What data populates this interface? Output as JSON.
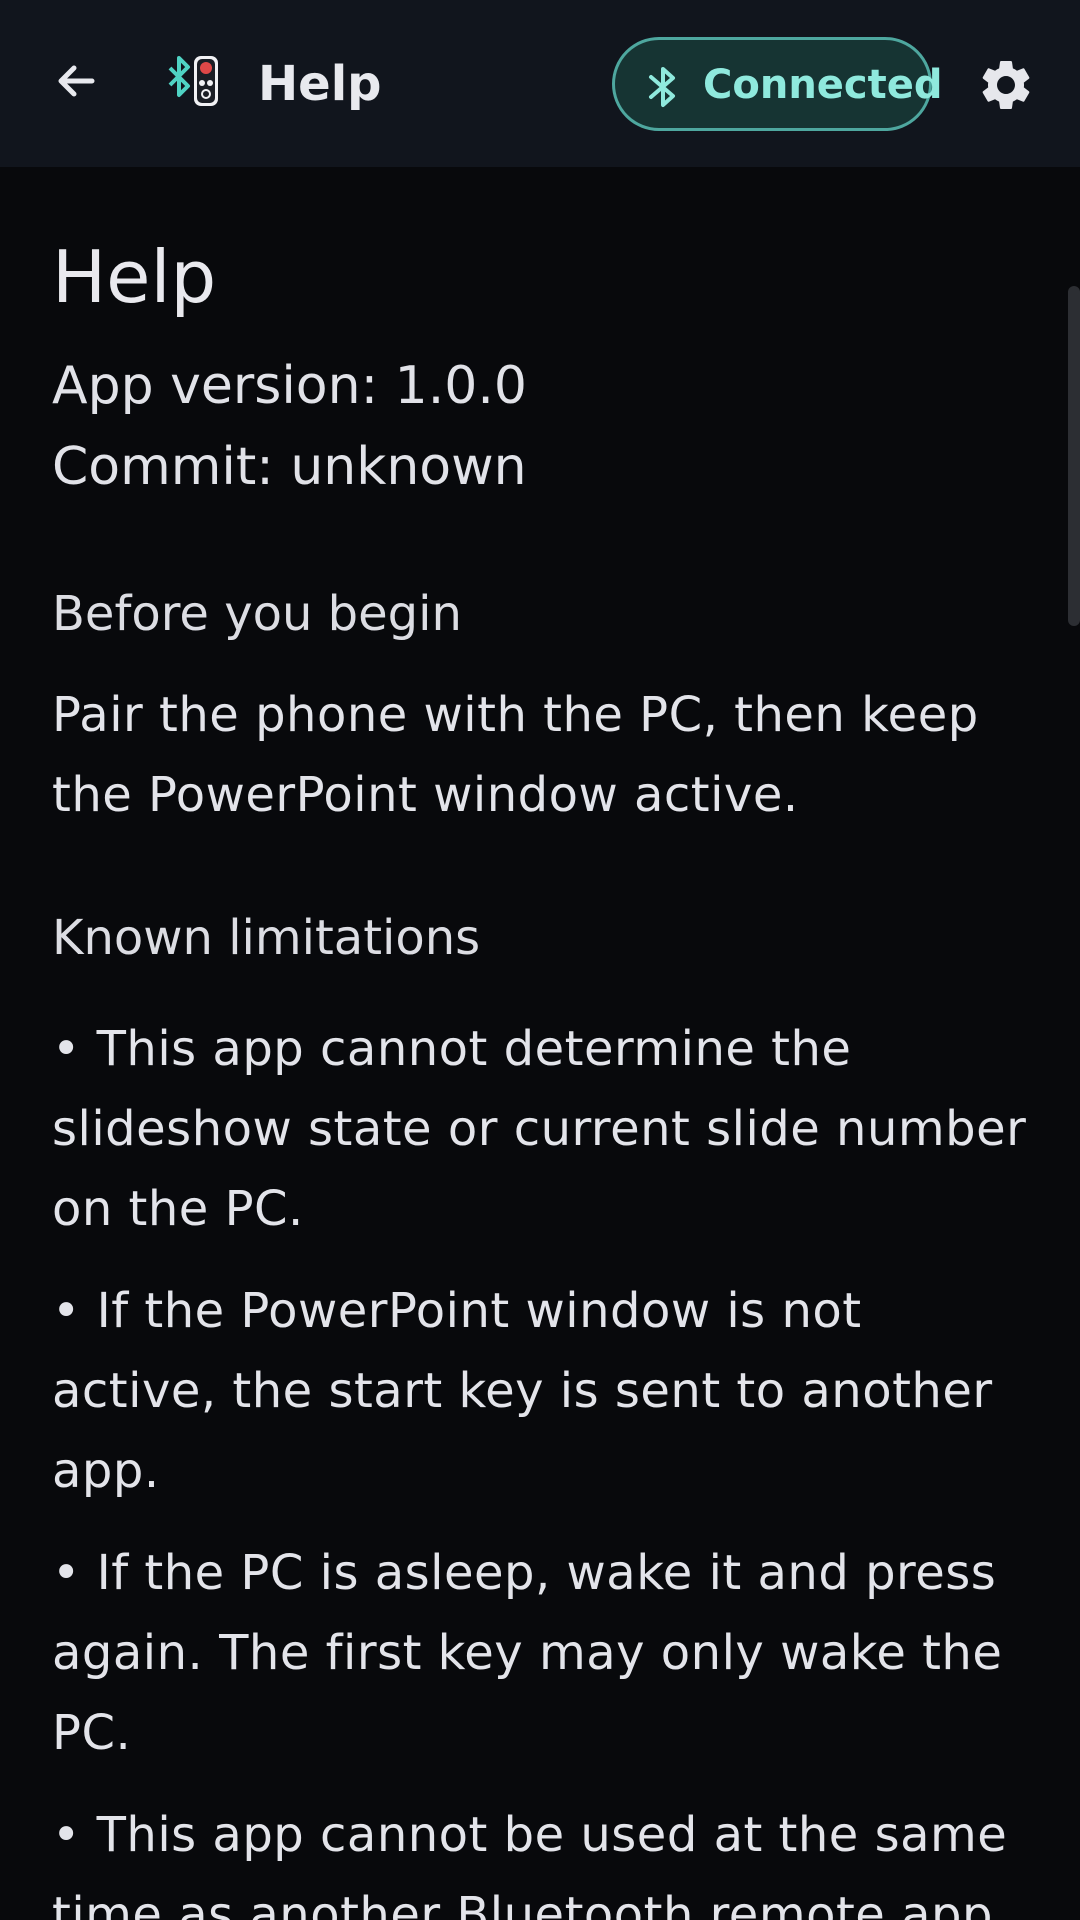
{
  "app_bar": {
    "title": "Help",
    "back_label": "Back",
    "settings_label": "Settings",
    "status": {
      "label": "Connected",
      "icon": "bluetooth-icon",
      "accent_color": "#8fe9dd",
      "border_color": "#4ea79f"
    },
    "logo_icon": "bluetooth-remote-logo-icon"
  },
  "help": {
    "title": "Help",
    "app_version": "App version: 1.0.0",
    "commit": "Commit: unknown",
    "sections": [
      {
        "heading": "Before you begin",
        "paragraphs": [
          "Pair the phone with the PC, then keep the PowerPoint window active."
        ]
      },
      {
        "heading": "Known limitations",
        "paragraphs": [
          "• This app cannot determine the slideshow state or current slide number on the PC.",
          "• If the PowerPoint window is not active, the start key is sent to another app.",
          "• If the PC is asleep, wake it and press again. The first key may only wake the PC.",
          "• This app cannot be used at the same time as another Bluetooth remote app."
        ]
      }
    ]
  },
  "colors": {
    "background": "#08090c",
    "app_bar": "#11151d",
    "text": "#e6e6ea"
  }
}
